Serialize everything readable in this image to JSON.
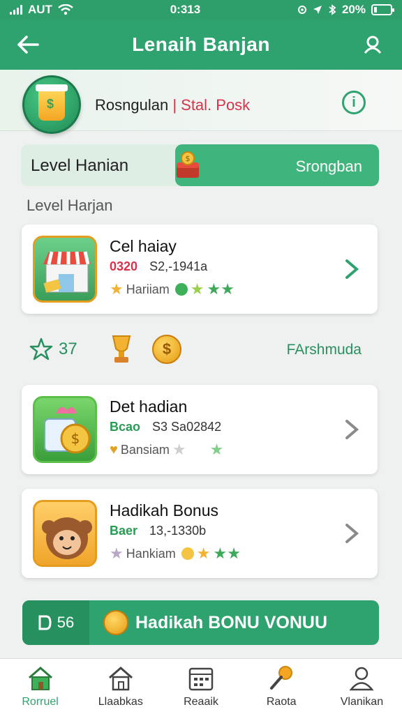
{
  "status_bar": {
    "carrier": "AUT",
    "time": "0:313",
    "battery": "20%",
    "battery_level": 0.2
  },
  "app_bar": {
    "title": "Lenaih Banjan"
  },
  "promo": {
    "text_main": "Rosngulan",
    "text_accent": "| Stal. Posk"
  },
  "level": {
    "left_label": "Level Hanian",
    "right_label": "Srongban",
    "progress": 0.57
  },
  "section": {
    "label": "Level Harjan"
  },
  "cards": [
    {
      "name": "Cel haiay",
      "tag": "0320",
      "code": "S2,-1941a",
      "rating_label": "Hariiam",
      "tag_color": "#d8334a"
    },
    {
      "name": "Det hadian",
      "tag": "Bcao",
      "code": "S3 Sa02842",
      "rating_label": "Bansiam",
      "tag_color": "#2a9b54"
    },
    {
      "name": "Hadikah Bonus",
      "tag": "Baer",
      "code": "13,-1330b",
      "rating_label": "Hankiam",
      "tag_color": "#2a9b54"
    }
  ],
  "stats": {
    "stars": "37",
    "coin_symbol": "$",
    "link": "FArshmuda"
  },
  "cta": {
    "count": "56",
    "label": "Hadikah BONU VONUU"
  },
  "nav": [
    {
      "label": "Rorruel",
      "icon": "home-icon"
    },
    {
      "label": "Llaabkas",
      "icon": "house-icon"
    },
    {
      "label": "Reaaik",
      "icon": "calendar-icon"
    },
    {
      "label": "Raota",
      "icon": "pin-icon"
    },
    {
      "label": "Vlanikan",
      "icon": "user-icon"
    }
  ],
  "colors": {
    "primary": "#2fa36f",
    "accent_red": "#d8334a",
    "gold": "#f4b233"
  }
}
